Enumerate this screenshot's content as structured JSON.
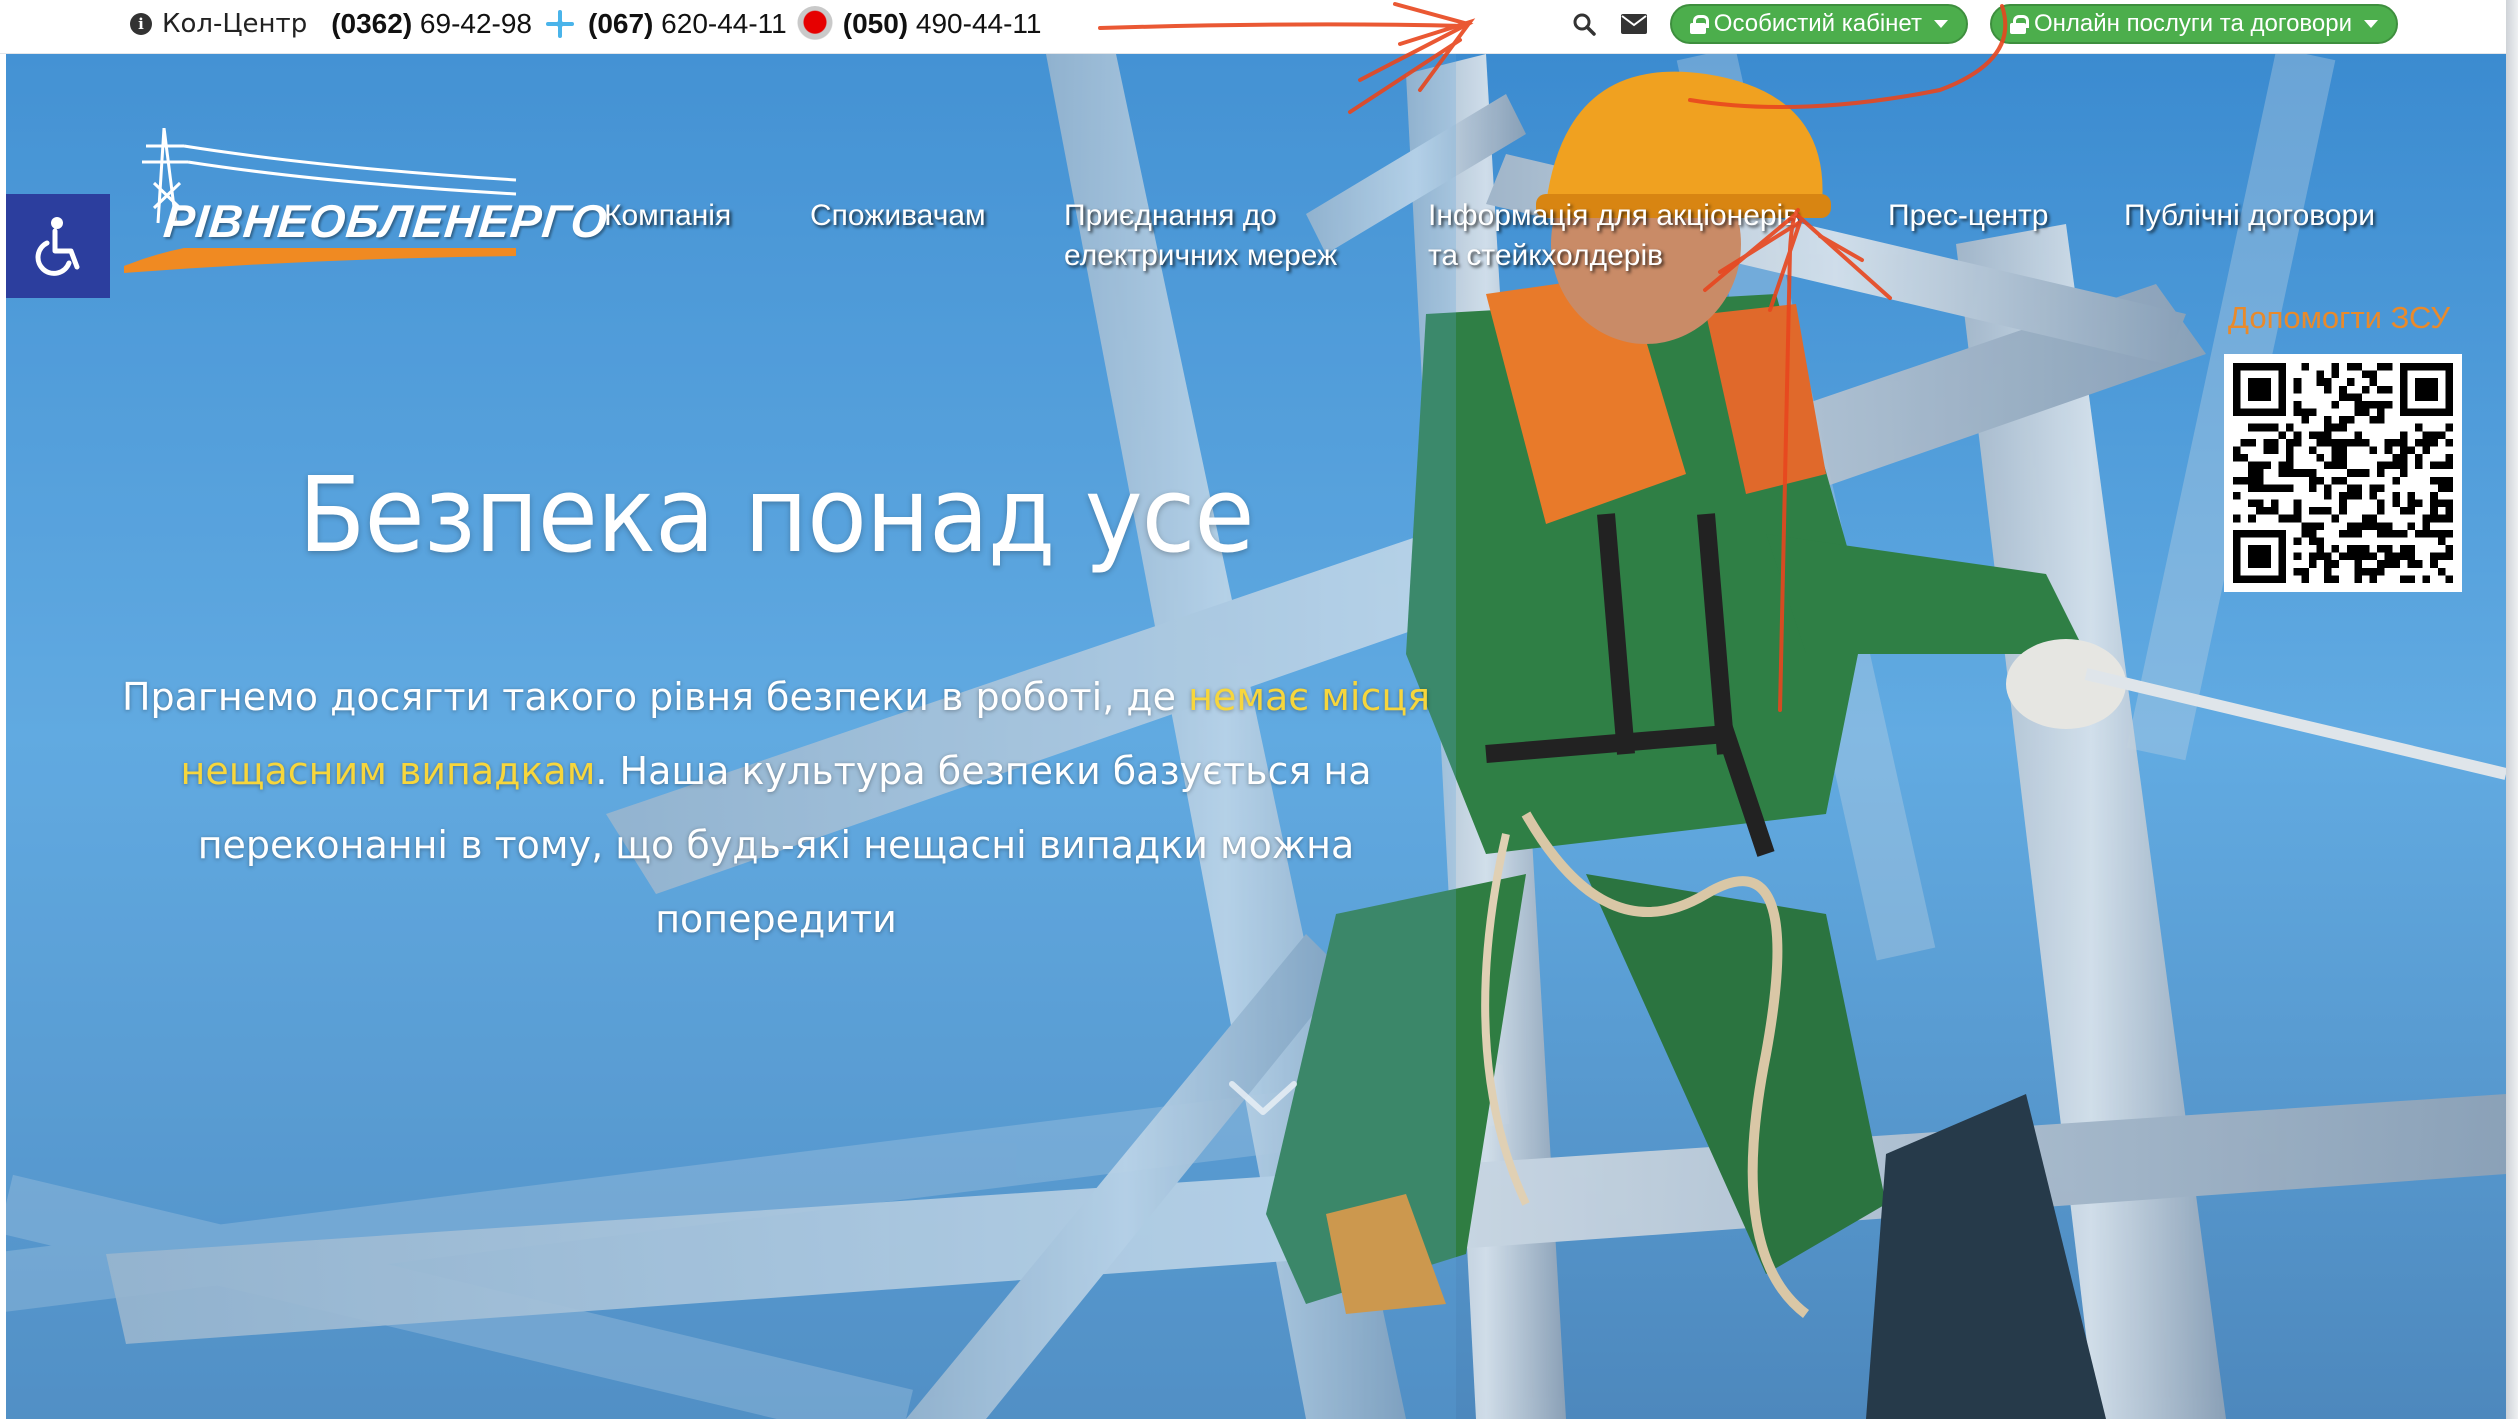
{
  "topbar": {
    "callcenter_label": "Кол-Центр",
    "phones": [
      {
        "code": "(0362)",
        "number": "69-42-98"
      },
      {
        "code": "(067)",
        "number": "620-44-11"
      },
      {
        "code": "(050)",
        "number": "490-44-11"
      }
    ],
    "personal_cabinet": "Особистий кабінет",
    "online_services": "Онлайн послуги та договори"
  },
  "logo": {
    "text": "РІВНЕОБЛЕНЕРГО"
  },
  "nav": [
    {
      "label": "Компанія"
    },
    {
      "label": "Споживачам"
    },
    {
      "line1": "Приєднання до",
      "line2": "електричних мереж"
    },
    {
      "line1": "Інформація для акціонерів",
      "line2": "та стейкхолдерів"
    },
    {
      "label": "Прес-центр"
    },
    {
      "label": "Публічні договори"
    }
  ],
  "help": {
    "label": "Допомогти ЗСУ"
  },
  "hero": {
    "title": "Безпека понад усе",
    "text_part1": "Прагнемо досягти такого рівня безпеки в роботі, де ",
    "text_highlight": "немає місця нещасним випадкам",
    "text_part2": ". Наша культура безпеки базується на переконанні в тому, що будь-які нещасні випадки можна попередити"
  },
  "colors": {
    "green_button": "#4cae4c",
    "accent_orange": "#e98a2b",
    "highlight_yellow": "#f7d63c",
    "accessibility_blue": "#2c3e9e",
    "annotation_red": "#e8461e"
  },
  "icons": [
    "info-icon",
    "kyivstar-icon",
    "vodafone-icon",
    "search-icon",
    "mail-icon",
    "lock-icon",
    "wheelchair-icon",
    "chevron-down-icon"
  ]
}
